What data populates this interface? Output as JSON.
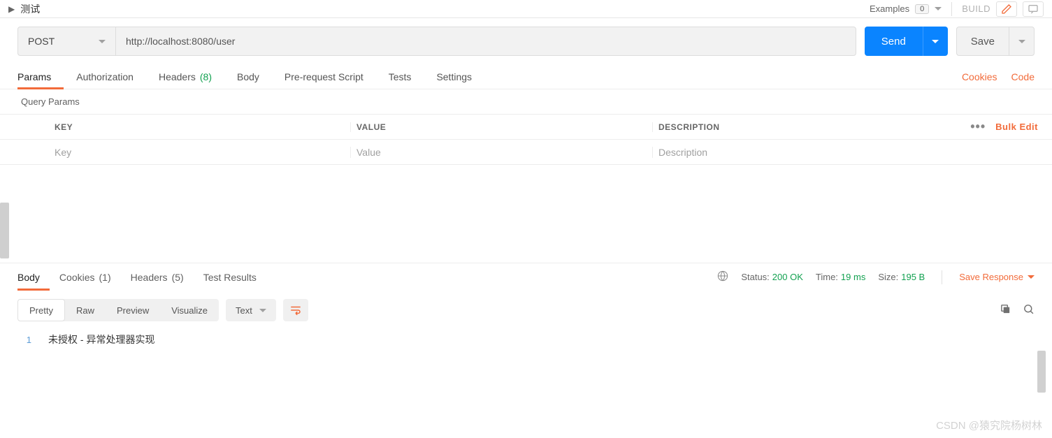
{
  "header": {
    "tab_title": "测试",
    "examples_label": "Examples",
    "examples_count": "0",
    "build_label": "BUILD"
  },
  "request": {
    "method": "POST",
    "url": "http://localhost:8080/user",
    "send_label": "Send",
    "save_label": "Save"
  },
  "req_tabs": {
    "params": "Params",
    "auth": "Authorization",
    "headers": "Headers",
    "headers_count": "(8)",
    "body": "Body",
    "prerequest": "Pre-request Script",
    "tests": "Tests",
    "settings": "Settings",
    "cookies_link": "Cookies",
    "code_link": "Code"
  },
  "params": {
    "section_label": "Query Params",
    "header_key": "KEY",
    "header_value": "VALUE",
    "header_desc": "DESCRIPTION",
    "placeholder_key": "Key",
    "placeholder_value": "Value",
    "placeholder_desc": "Description",
    "bulk_edit": "Bulk Edit"
  },
  "resp_tabs": {
    "body": "Body",
    "cookies": "Cookies",
    "cookies_count": "(1)",
    "headers": "Headers",
    "headers_count": "(5)",
    "tests": "Test Results"
  },
  "status": {
    "status_label": "Status:",
    "status_val": "200 OK",
    "time_label": "Time:",
    "time_val": "19 ms",
    "size_label": "Size:",
    "size_val": "195 B",
    "save_response": "Save Response"
  },
  "format_bar": {
    "pretty": "Pretty",
    "raw": "Raw",
    "preview": "Preview",
    "visualize": "Visualize",
    "format": "Text"
  },
  "response_body": {
    "line_no": "1",
    "line_text": "未授权 - 异常处理器实现"
  },
  "watermark": "CSDN @猿究院杨树林"
}
